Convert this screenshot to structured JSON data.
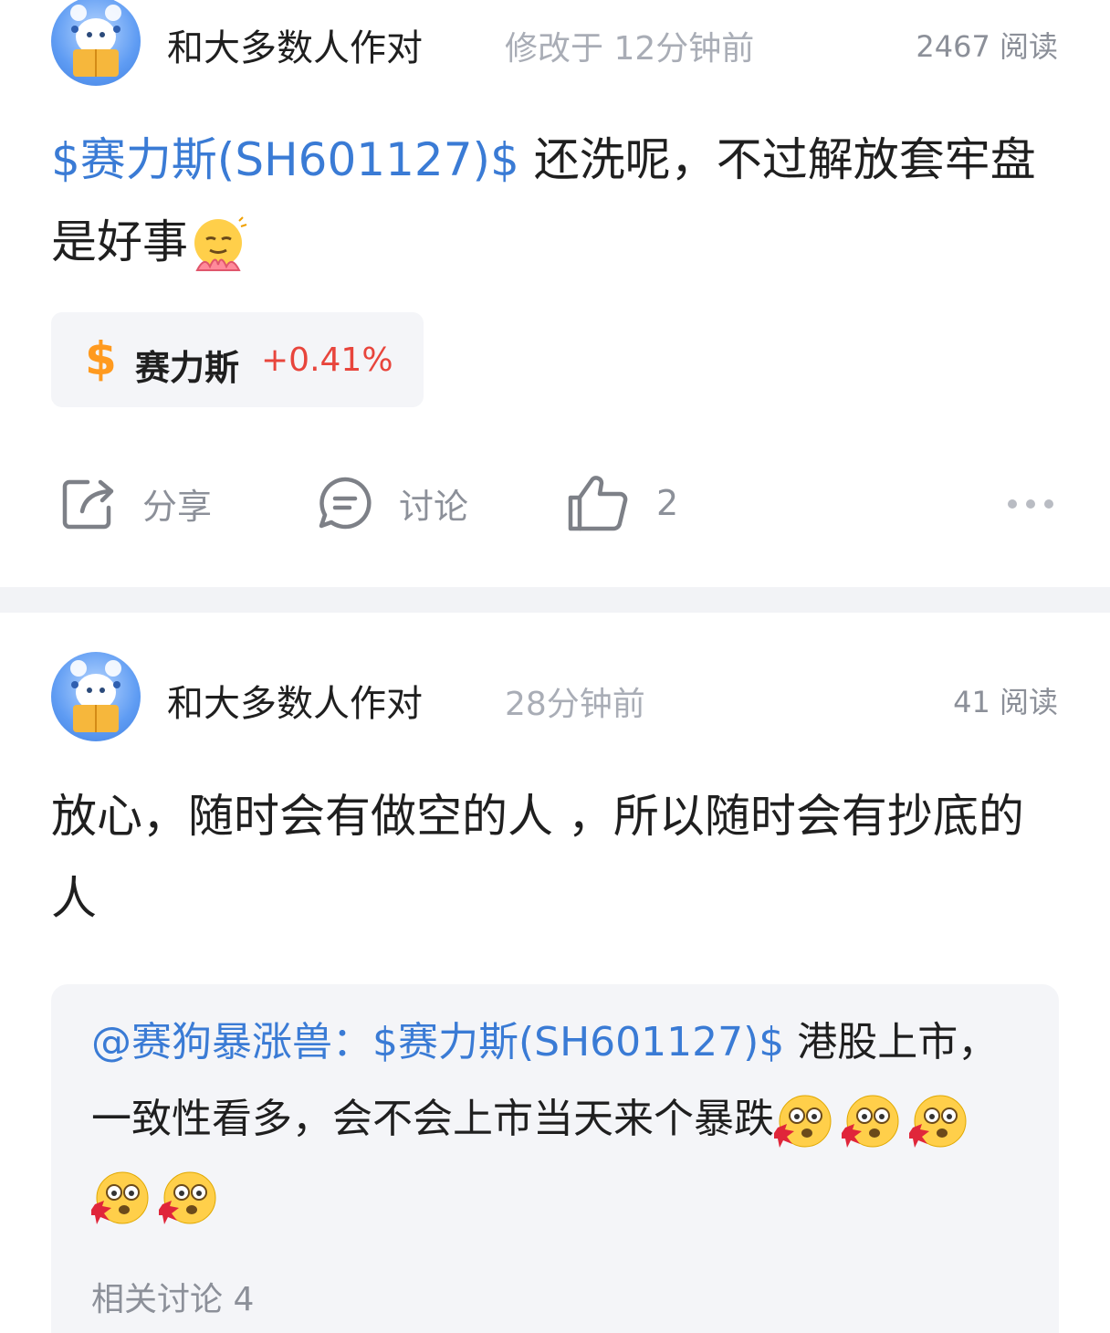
{
  "post1": {
    "author": "和大多数人作对",
    "time": "修改于 12分钟前",
    "reads": "2467 阅读",
    "tag": "$赛力斯(SH601127)$",
    "text": " 还洗呢，不过解放套牢盘是好事",
    "emoji": "smirk-lotus-emoji",
    "stock": {
      "name": "赛力斯",
      "change": "+0.41%"
    },
    "actions": {
      "share": "分享",
      "discuss": "讨论",
      "likes": "2"
    }
  },
  "post2": {
    "author": "和大多数人作对",
    "time": "28分钟前",
    "reads": "41 阅读",
    "text": "放心，随时会有做空的人 ，所以随时会有抄底的人",
    "quote": {
      "user": "@赛狗暴涨兽：",
      "tag": "$赛力斯(SH601127)$",
      "text": " 港股上市，一致性看多，会不会上市当天来个暴跌",
      "emoji": "shocked-bleeding-emoji",
      "emoji_count": 5
    },
    "related": "相关讨论 4"
  },
  "colors": {
    "link": "#3a7bd5",
    "up": "#e8453c",
    "dollar": "#ff9a1f",
    "muted": "#8c9099",
    "card_bg": "#f4f5f8"
  }
}
